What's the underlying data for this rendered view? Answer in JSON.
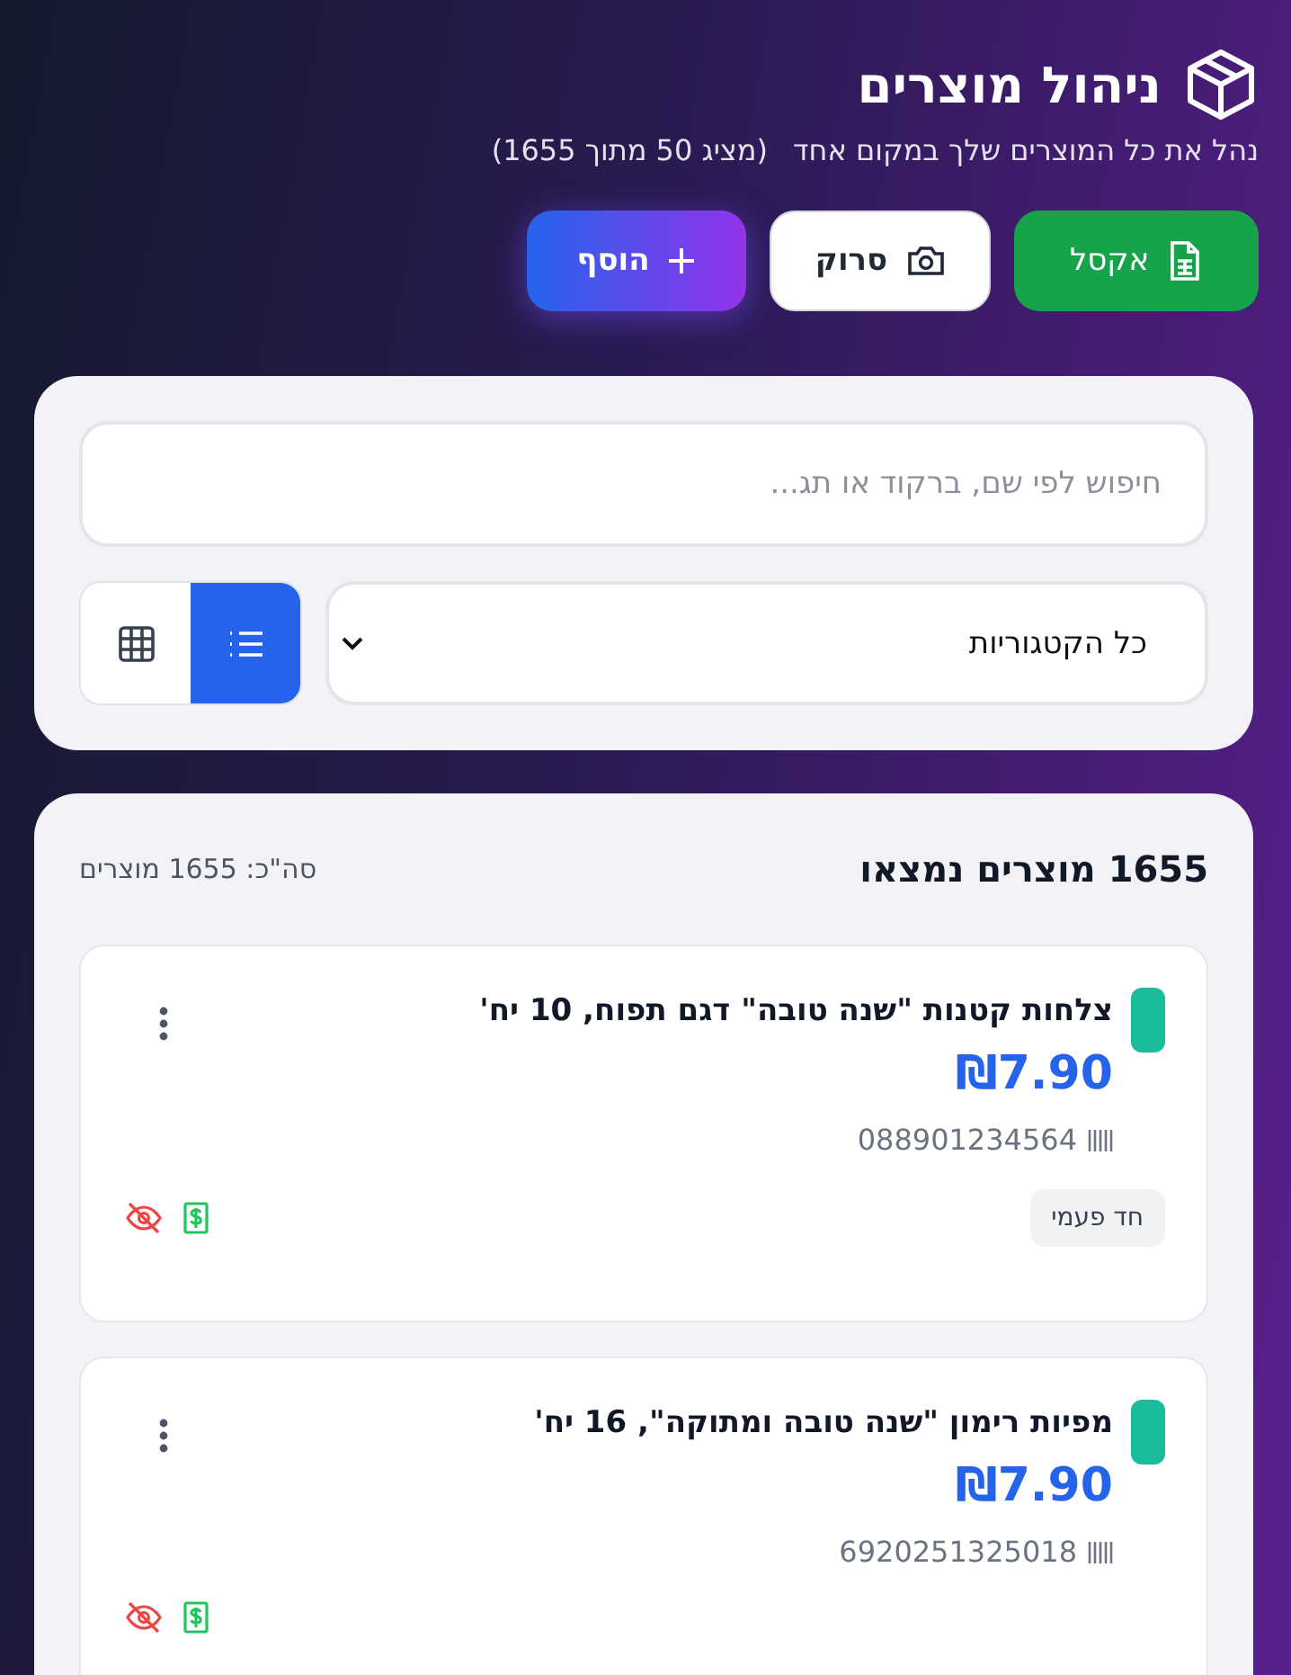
{
  "header": {
    "title": "ניהול מוצרים",
    "subtitle": "נהל את כל המוצרים שלך במקום אחד",
    "count_note": "(מציג 50 מתוך 1655)"
  },
  "actions": [
    {
      "kind": "excel",
      "label": "אקסל"
    },
    {
      "kind": "scan",
      "label": "סרוק"
    },
    {
      "kind": "add",
      "label": "הוסף"
    }
  ],
  "filters": {
    "search": {
      "placeholder": "חיפוש לפי שם, ברקוד או תג..."
    },
    "category": "כל הקטגוריות",
    "views": [
      {
        "kind": "list",
        "selected": true
      },
      {
        "kind": "grid",
        "selected": false
      }
    ]
  },
  "results": {
    "title": "1655 מוצרים נמצאו",
    "total": "סה\"כ: 1655 מוצרים"
  },
  "products": [
    {
      "name": "צלחות קטנות \"שנה טובה\" דגם תפוח, 10 יח'",
      "price": "₪7.90",
      "barcode": "088901234564",
      "tag": "חד פעמי",
      "color": "#1abc9c",
      "hidden": true
    },
    {
      "name": "מפיות רימון \"שנה טובה ומתוקה\", 16 יח'",
      "price": "₪7.90",
      "barcode": "6920251325018",
      "color": "#1abc9c",
      "hidden": true
    }
  ]
}
